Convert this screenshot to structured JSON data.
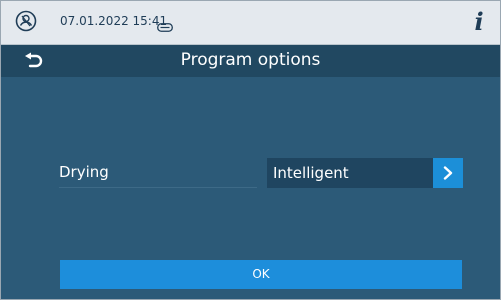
{
  "status_bar": {
    "datetime": "07.01.2022 15:41",
    "logo_icon": "device-logo-icon",
    "card_icon": "card-icon",
    "info_label": "i"
  },
  "header": {
    "title": "Program options",
    "back_icon": "back-arrow-icon"
  },
  "options": [
    {
      "label": "Drying",
      "value": "Intelligent"
    }
  ],
  "footer": {
    "ok_label": "OK"
  },
  "colors": {
    "status_bg": "#e4e9ee",
    "title_bg": "#214861",
    "content_bg": "#2c5a78",
    "accent": "#1c8fd8"
  }
}
